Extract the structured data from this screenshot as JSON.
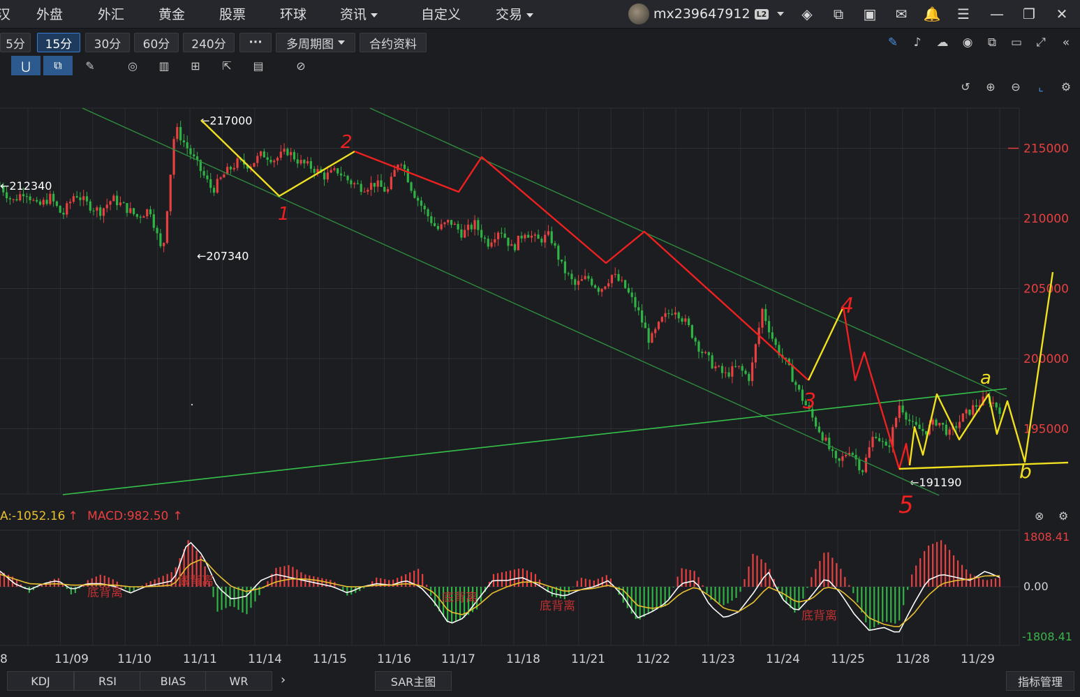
{
  "nav": {
    "items": [
      "汉",
      "外盘",
      "外汇",
      "黄金",
      "股票",
      "环球",
      "资讯",
      "自定义",
      "交易"
    ],
    "user": "mx239647912",
    "badge": "L2"
  },
  "periods": {
    "buttons": [
      "5分",
      "15分",
      "30分",
      "60分",
      "240分",
      "···",
      "多周期图",
      "合约资料"
    ],
    "active": "15分"
  },
  "macd": {
    "dea_label": "A:-1052.16",
    "macd_label": "MACD:982.50",
    "top": "1808.41",
    "zero": "0.00",
    "bottom": "-1808.41"
  },
  "bottom": {
    "tabs": [
      "KDJ",
      "RSI",
      "BIAS",
      "WR",
      "SAR主图"
    ],
    "manage": "指标管理"
  },
  "chart_data": {
    "type": "candlestick",
    "x_labels": [
      "8",
      "11/09",
      "11/10",
      "11/11",
      "11/14",
      "11/15",
      "11/16",
      "11/17",
      "11/18",
      "11/21",
      "11/22",
      "11/23",
      "11/24",
      "11/25",
      "11/28",
      "11/29"
    ],
    "y_ticks": [
      215000,
      210000,
      205000,
      200000,
      195000
    ],
    "ylim": [
      190000,
      218000
    ],
    "annotations": [
      {
        "label": "←217000",
        "value": 217000
      },
      {
        "label": "←212340",
        "value": 212340
      },
      {
        "label": "←207340",
        "value": 207340
      },
      {
        "label": "←191190",
        "value": 191190
      }
    ],
    "path": [
      212340,
      211200,
      212000,
      210800,
      211500,
      210200,
      211800,
      211000,
      210500,
      211400,
      210800,
      210100,
      210700,
      207340,
      216500,
      215000,
      213500,
      212000,
      213200,
      214000,
      213800,
      214600,
      214200,
      214800,
      214000,
      213600,
      213000,
      213400,
      212600,
      212200,
      212500,
      211900,
      214400,
      212000,
      210500,
      209200,
      209800,
      208900,
      209600,
      208200,
      209300,
      207800,
      209100,
      208400,
      208800,
      206500,
      205200,
      205800,
      204900,
      206000,
      205100,
      203500,
      201200,
      202800,
      203600,
      202400,
      200700,
      199600,
      198800,
      199400,
      198600,
      203500,
      201000,
      199500,
      197500,
      195800,
      194200,
      192400,
      193600,
      192000,
      194800,
      193400,
      196800,
      195200,
      194800,
      195600,
      194600,
      195800,
      196600,
      197200,
      196400
    ],
    "macd_hist": [
      500,
      300,
      -200,
      100,
      300,
      -300,
      200,
      400,
      200,
      -200,
      100,
      300,
      500,
      1500,
      900,
      -800,
      -600,
      -900,
      -200,
      600,
      700,
      400,
      300,
      200,
      -300,
      -100,
      300,
      200,
      400,
      600,
      -600,
      -1200,
      -1000,
      -700,
      400,
      500,
      600,
      400,
      -300,
      -400,
      300,
      200,
      400,
      -500,
      -1100,
      -800,
      -600,
      600,
      500,
      -400,
      -600,
      -300,
      1100,
      700,
      -400,
      -900,
      300,
      1200,
      600,
      -300,
      -1400,
      -1100,
      -1200,
      500,
      1300,
      1500,
      900,
      400,
      200,
      300
    ],
    "macd_diff": [
      500,
      100,
      -100,
      100,
      200,
      -100,
      100,
      100,
      0,
      -200,
      0,
      100,
      200,
      1500,
      1000,
      0,
      -400,
      -300,
      200,
      400,
      300,
      200,
      100,
      0,
      -200,
      0,
      100,
      50,
      200,
      0,
      -500,
      -1200,
      -1000,
      -400,
      200,
      200,
      300,
      100,
      -200,
      -300,
      -100,
      0,
      200,
      -300,
      -1000,
      -800,
      -500,
      100,
      200,
      -600,
      -1000,
      -800,
      -200,
      500,
      -400,
      -800,
      -300,
      300,
      -200,
      -900,
      -1400,
      -1300,
      -1500,
      -600,
      200,
      400,
      300,
      200,
      500,
      300
    ],
    "macd_dea": [
      400,
      250,
      100,
      80,
      100,
      50,
      60,
      70,
      50,
      0,
      0,
      20,
      60,
      700,
      900,
      400,
      0,
      -150,
      -50,
      150,
      250,
      250,
      200,
      100,
      0,
      0,
      50,
      50,
      100,
      50,
      -200,
      -800,
      -900,
      -600,
      -200,
      0,
      150,
      150,
      0,
      -150,
      -100,
      -50,
      50,
      -100,
      -600,
      -700,
      -600,
      -200,
      0,
      -300,
      -700,
      -800,
      -500,
      0,
      -200,
      -500,
      -400,
      0,
      -100,
      -500,
      -1000,
      -1200,
      -1300,
      -900,
      -300,
      100,
      200,
      250,
      350,
      350
    ]
  }
}
